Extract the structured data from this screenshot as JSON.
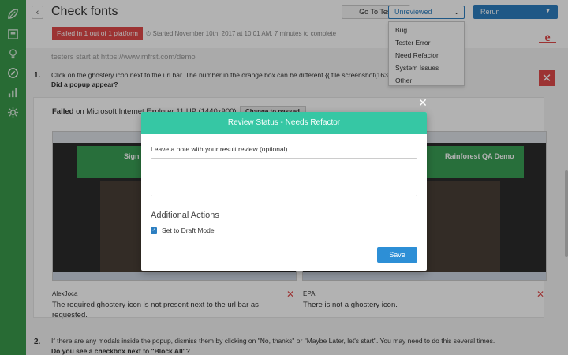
{
  "header": {
    "title": "Check fonts",
    "goto_test": "Go To Test",
    "status_select": "Unreviewed",
    "rerun": "Rerun",
    "fail_badge": "Failed in 1 out of 1 platform",
    "started": "Started November 10th, 2017 at 10:01 AM, 7 minutes to complete"
  },
  "status_options": [
    "Bug",
    "Tester Error",
    "Need Refactor",
    "System Issues",
    "Other"
  ],
  "test": {
    "start_url": "testers start at https://www.rnfrst.com/demo",
    "steps": [
      {
        "num": "1.",
        "text": "Click on the ghostery icon next to the url bar. The number in the orange box can be different.{{ file.screenshot(16345, \\",
        "question": "Did a popup appear?"
      },
      {
        "num": "2.",
        "text": "If there are any modals inside the popup, dismiss them by clicking on \"No, thanks\" or \"Maybe Later, let's start\". You may need to do this several times.",
        "question": "Do you see a checkbox next to \"Block All\"?"
      }
    ],
    "platform_failed_label": "Failed",
    "platform_name": "on Microsoft Internet Explorer 11 UP (1440x900)",
    "change_passed": "Change to passed",
    "results": [
      {
        "tester": "AlexJoca",
        "comment": "The required ghostery icon is not present next to the url bar as requested.",
        "shot_text": "Sign Up fo"
      },
      {
        "tester": "EPA",
        "comment": "There is not a ghostery icon.",
        "shot_text": "Rainforest QA Demo"
      }
    ]
  },
  "modal": {
    "title": "Review Status - Needs Refactor",
    "note_label": "Leave a note with your result review (optional)",
    "note_value": "",
    "additional_actions": "Additional Actions",
    "draft_mode_label": "Set to Draft Mode",
    "draft_mode_checked": true,
    "save": "Save"
  },
  "colors": {
    "sidebar": "#3a9a4b",
    "primary": "#2d7fc1",
    "modal_header": "#36c7a4",
    "danger": "#e04a4a"
  }
}
